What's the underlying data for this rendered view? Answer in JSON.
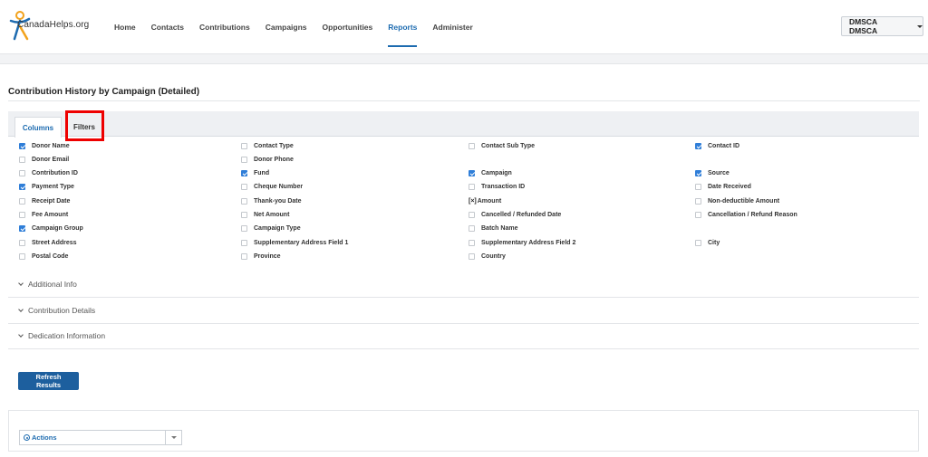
{
  "brand": {
    "name": "CanadaHelps.org"
  },
  "nav": {
    "items": [
      {
        "label": "Home",
        "active": false
      },
      {
        "label": "Contacts",
        "active": false
      },
      {
        "label": "Contributions",
        "active": false
      },
      {
        "label": "Campaigns",
        "active": false
      },
      {
        "label": "Opportunities",
        "active": false
      },
      {
        "label": "Reports",
        "active": true
      },
      {
        "label": "Administer",
        "active": false
      }
    ],
    "user_label": "DMSCA DMSCA"
  },
  "page": {
    "title": "Contribution History by Campaign (Detailed)"
  },
  "tabs": {
    "columns": "Columns",
    "filters": "Filters"
  },
  "columns": {
    "rows": [
      [
        {
          "label": "Donor Name",
          "checked": true
        },
        {
          "label": "Contact Type",
          "checked": false
        },
        {
          "label": "Contact Sub Type",
          "checked": false
        },
        {
          "label": "Contact ID",
          "checked": true
        }
      ],
      [
        {
          "label": "Donor Email",
          "checked": false
        },
        {
          "label": "Donor Phone",
          "checked": false
        }
      ],
      [
        {
          "label": "Contribution ID",
          "checked": false
        },
        {
          "label": "Fund",
          "checked": true
        },
        {
          "label": "Campaign",
          "checked": true
        },
        {
          "label": "Source",
          "checked": true
        }
      ],
      [
        {
          "label": "Payment Type",
          "checked": true
        },
        {
          "label": "Cheque Number",
          "checked": false
        },
        {
          "label": "Transaction ID",
          "checked": false
        },
        {
          "label": "Date Received",
          "checked": false
        }
      ],
      [
        {
          "label": "Receipt Date",
          "checked": false
        },
        {
          "label": "Thank-you Date",
          "checked": false
        },
        {
          "label": "Amount",
          "checked": false,
          "fixed": true,
          "fixed_mark": "[×]"
        },
        {
          "label": "Non-deductible Amount",
          "checked": false
        }
      ],
      [
        {
          "label": "Fee Amount",
          "checked": false
        },
        {
          "label": "Net Amount",
          "checked": false
        },
        {
          "label": "Cancelled / Refunded Date",
          "checked": false
        },
        {
          "label": "Cancellation / Refund Reason",
          "checked": false
        }
      ],
      [
        {
          "label": "Campaign Group",
          "checked": true
        },
        {
          "label": "Campaign Type",
          "checked": false
        },
        {
          "label": "Batch Name",
          "checked": false
        }
      ],
      [
        {
          "label": "Street Address",
          "checked": false
        },
        {
          "label": "Supplementary Address Field 1",
          "checked": false
        },
        {
          "label": "Supplementary Address Field 2",
          "checked": false
        },
        {
          "label": "City",
          "checked": false
        }
      ],
      [
        {
          "label": "Postal Code",
          "checked": false
        },
        {
          "label": "Province",
          "checked": false
        },
        {
          "label": "Country",
          "checked": false
        }
      ]
    ]
  },
  "sections": [
    {
      "label": "Additional Info"
    },
    {
      "label": "Contribution Details"
    },
    {
      "label": "Dedication Information"
    }
  ],
  "buttons": {
    "refresh": "Refresh Results"
  },
  "actions": {
    "label": "Actions"
  },
  "colors": {
    "accent": "#1d6bb0",
    "button": "#1d5f9e",
    "checkbox": "#2f7ed8",
    "highlight": "#e00000"
  }
}
